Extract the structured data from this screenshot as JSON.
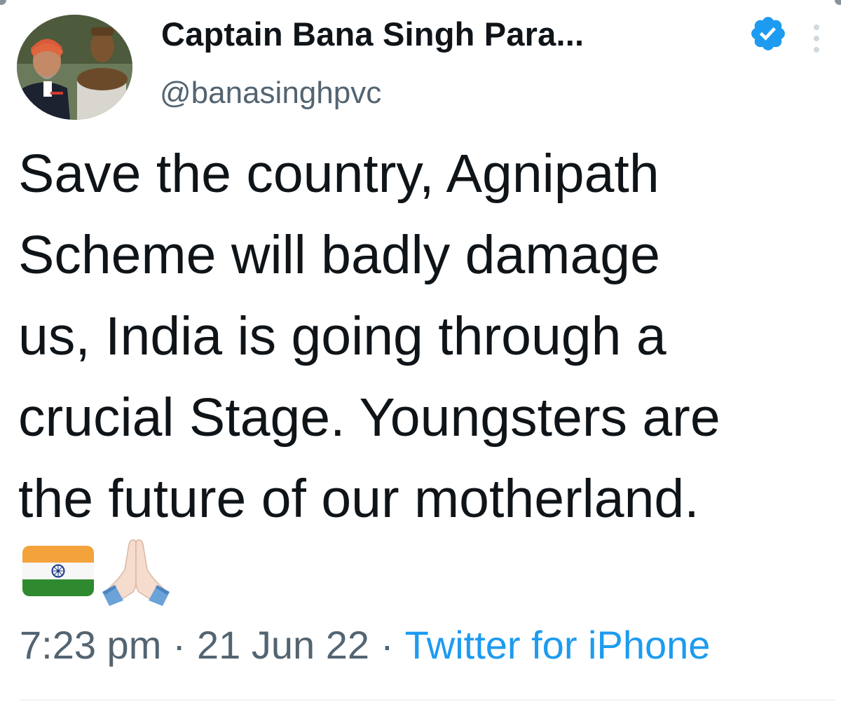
{
  "tweet": {
    "author": {
      "display_name": "Captain Bana Singh Para...",
      "handle": "@banasinghpvc",
      "verified": true,
      "avatar_icon": "profile-photo"
    },
    "text_lines": [
      "Save the country, Agnipath",
      "Scheme will badly damage",
      "us, India is going through a",
      "crucial Stage. Youngsters are",
      "the future of our motherland."
    ],
    "emojis": [
      "india-flag-emoji",
      "folded-hands-emoji"
    ],
    "time": "7:23 pm",
    "separator": "·",
    "date": "21 Jun 22",
    "source": "Twitter for iPhone"
  },
  "colors": {
    "text_primary": "#0f1419",
    "text_secondary": "#536471",
    "link": "#1d9bf0",
    "verified_badge": "#1d9bf0"
  },
  "icons": {
    "verified": "verified-badge-icon",
    "more": "more-vertical-icon"
  }
}
